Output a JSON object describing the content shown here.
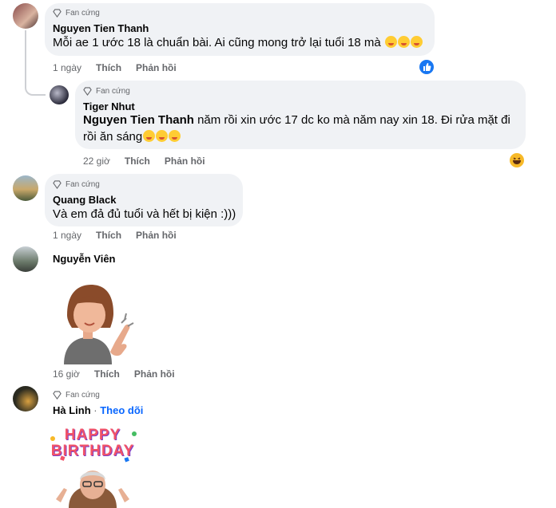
{
  "comments": [
    {
      "badge": "Fan cứng",
      "author": "Nguyen Tien Thanh",
      "text": "Mỗi ae 1 ước 18 là chuẩn bài. Ai cũng mong trở lại tuổi 18 mà",
      "time": "1 ngày",
      "like": "Thích",
      "reply": "Phản hồi",
      "reaction": "like"
    },
    {
      "badge": "Fan cứng",
      "author": "Tiger Nhut",
      "mention": "Nguyen Tien Thanh",
      "text_line1": " năm rồi xin ước 17 dc ko mà năm nay xin 18. Đi rửa mặt đi",
      "text_line2": "rồi ăn sáng",
      "time": "22 giờ",
      "like": "Thích",
      "reply": "Phản hồi",
      "reaction": "haha"
    },
    {
      "badge": "Fan cứng",
      "author": "Quang Black",
      "text": "Và em đả đủ tuổi và hết bị kiện :)))",
      "time": "1 ngày",
      "like": "Thích",
      "reply": "Phản hồi"
    },
    {
      "author": "Nguyễn Viên",
      "sticker": "clapping-avatar-sticker",
      "time": "16 giờ",
      "like": "Thích",
      "reply": "Phản hồi"
    },
    {
      "badge": "Fan cứng",
      "author": "Hà Linh",
      "separator": " · ",
      "follow": "Theo dõi",
      "sticker": "happy-birthday-sticker",
      "sticker_text": "HAPPY BIRTHDAY"
    }
  ],
  "colors": {
    "bubble": "#f0f2f5",
    "meta": "#65676b",
    "link": "#0866ff",
    "like_blue": "#1877f2",
    "haha_yellow": "#f7b928"
  }
}
